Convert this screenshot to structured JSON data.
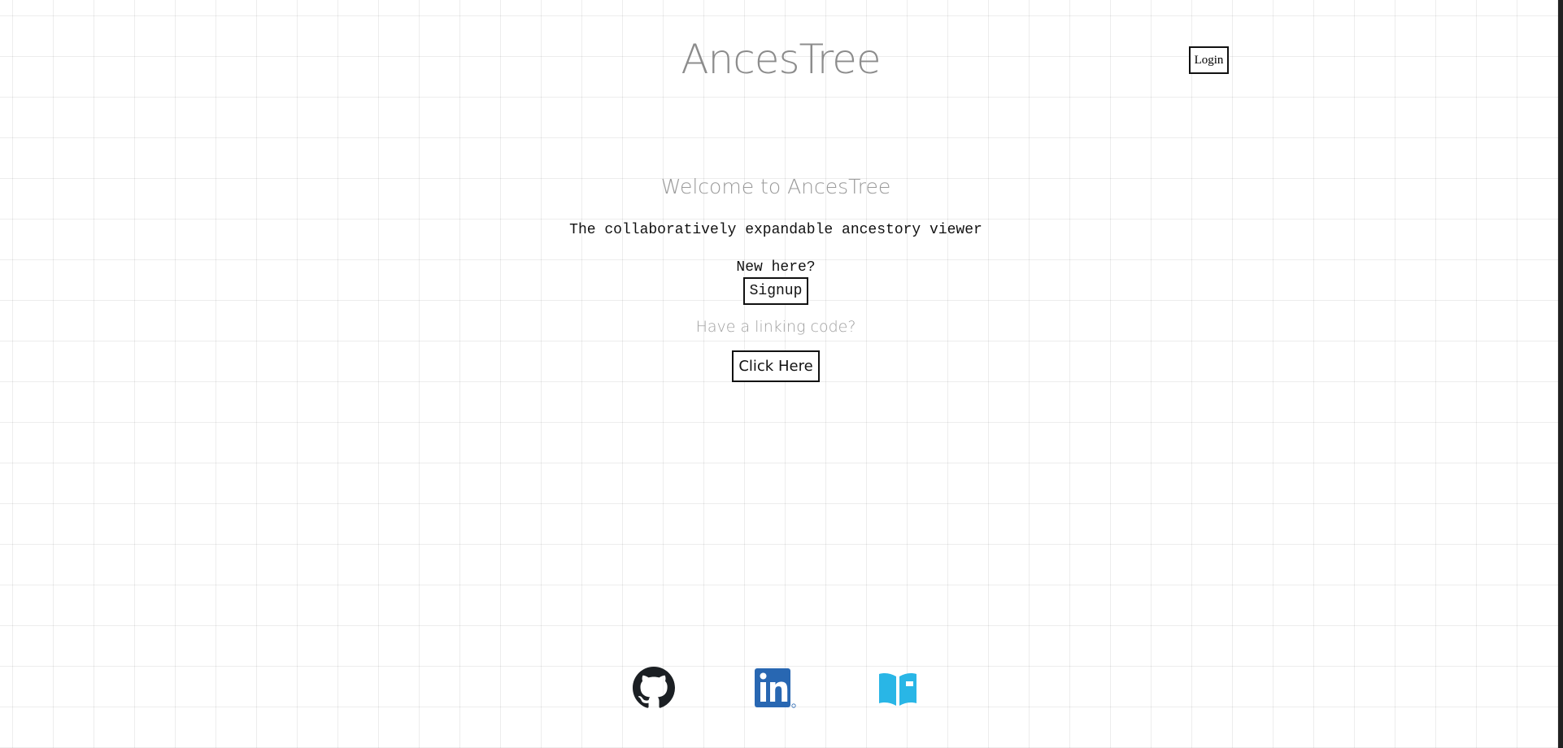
{
  "header": {
    "title": "AncesTree",
    "login_label": "Login"
  },
  "main": {
    "welcome": "Welcome to AncesTree",
    "tagline": "The collaboratively expandable ancestory viewer",
    "new_here": "New here?",
    "signup_label": "Signup",
    "linking_prompt": "Have a linking code?",
    "click_here_label": "Click Here"
  },
  "footer": {
    "links": [
      {
        "icon": "github-icon",
        "color": "#1b1f23"
      },
      {
        "icon": "linkedin-icon",
        "color": "#2867b2"
      },
      {
        "icon": "book-icon",
        "color": "#29b6e6"
      }
    ]
  },
  "colors": {
    "title_text": "#8c8c8c",
    "muted_text": "#9a9a9a",
    "body_text": "#111111",
    "grid_line": "#e5e5e5",
    "background": "#ffffff"
  }
}
